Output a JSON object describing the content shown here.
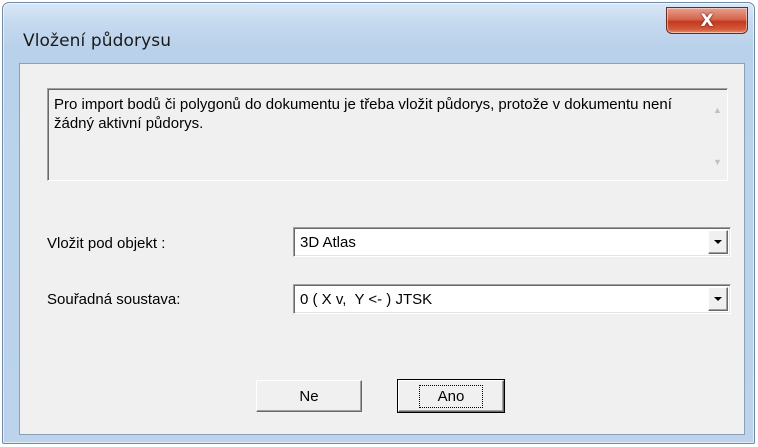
{
  "window": {
    "title": "Vložení půdorysu",
    "close_label": "X"
  },
  "message": {
    "text": "Pro import bodů či polygonů do dokumentu je třeba vložit půdorys, protože v dokumentu není žádný aktivní půdorys.",
    "scroll_up_icon": "up-arrow",
    "scroll_down_icon": "down-arrow"
  },
  "fields": {
    "object_label": "Vložit pod objekt :",
    "object_value": "3D Atlas",
    "coord_label": "Souřadná soustava:",
    "coord_value": "0 ( X v,  Y <- ) JTSK"
  },
  "buttons": {
    "no_label": "Ne",
    "yes_label": "Ano"
  }
}
